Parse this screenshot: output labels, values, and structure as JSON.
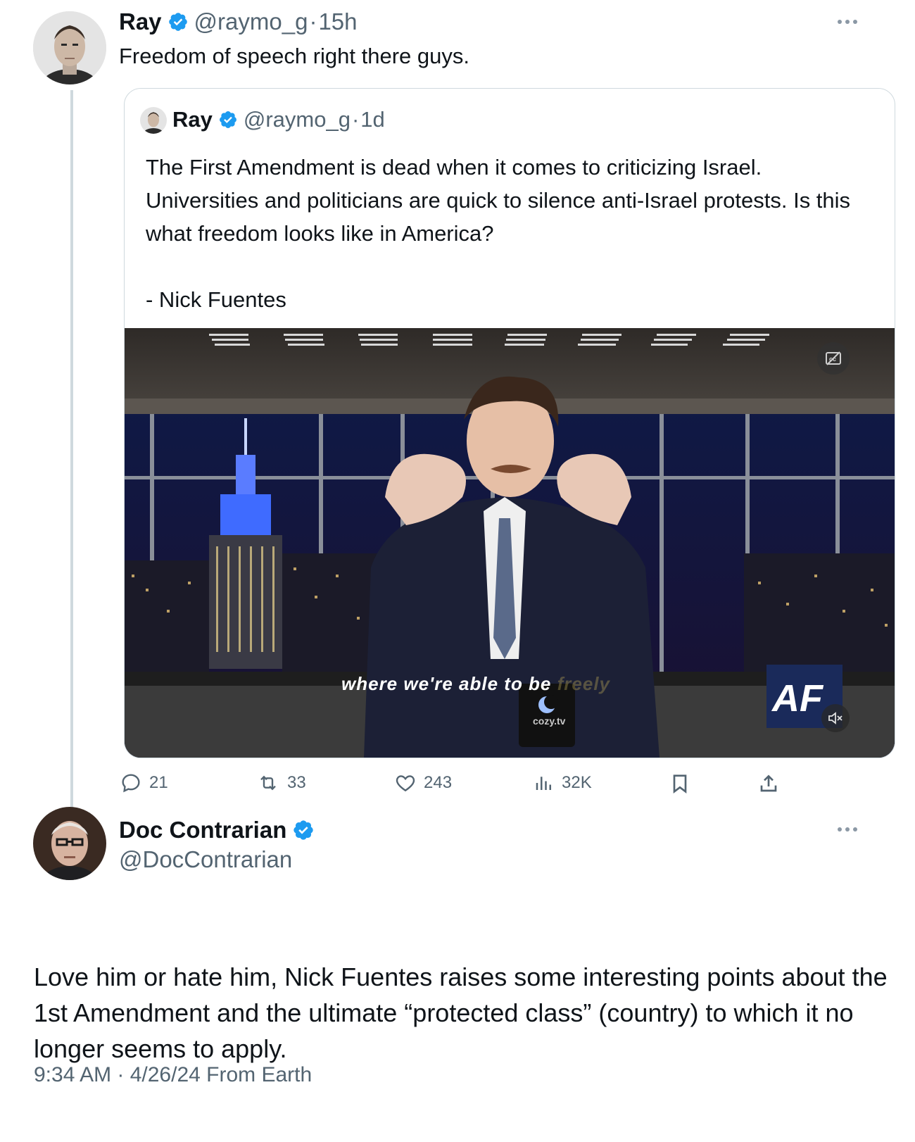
{
  "tweet1": {
    "author_name": "Ray",
    "handle": "@raymo_g",
    "separator": "·",
    "time": "15h",
    "text": "Freedom of speech right there guys."
  },
  "quoted": {
    "author_name": "Ray",
    "handle": "@raymo_g",
    "separator": "·",
    "time": "1d",
    "text": "The First Amendment is dead when it comes to criticizing Israel. Universities and politicians are quick to silence anti-Israel protests. Is this what freedom looks like in America?\n\n- Nick Fuentes",
    "video": {
      "caption": "where we're able to be",
      "caption_faded": "freely",
      "mug_text": "cozy.tv",
      "logo_text": "AF",
      "cc_icon": "captions-icon",
      "mute_icon": "volume-muted-icon"
    }
  },
  "actions": {
    "replies": "21",
    "reposts": "33",
    "likes": "243",
    "views": "32K"
  },
  "tweet2": {
    "author_name": "Doc Contrarian",
    "handle": "@DocContrarian",
    "text": "Love him or hate him, Nick Fuentes raises some interesting points about the 1st Amendment and the ultimate “protected class” (country) to which it no longer seems to apply.",
    "meta": "9:34 AM · 4/26/24 From Earth"
  },
  "colors": {
    "verified": "#1d9bf0",
    "muted": "#536471",
    "border": "#cfd9de"
  }
}
